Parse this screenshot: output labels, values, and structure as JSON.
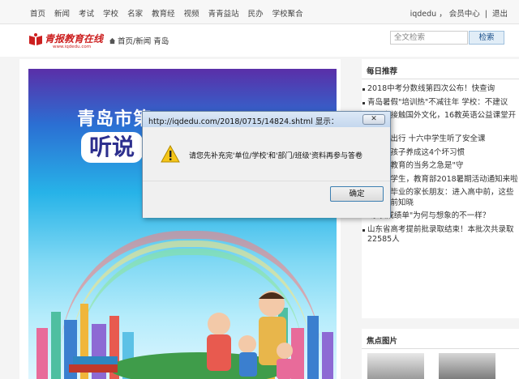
{
  "topbar": {
    "nav": [
      "首页",
      "新闻",
      "考试",
      "学校",
      "名家",
      "教育经",
      "视频",
      "青青益站",
      "民办",
      "学校聚合"
    ],
    "user": "iqdedu",
    "sep1": "，",
    "member_center": "会员中心",
    "sep2": "|",
    "logout": "退出"
  },
  "logo": {
    "name": "青报教育在线",
    "url": "www.iqdedu.com"
  },
  "breadcrumb": {
    "home": "首页",
    "sep": "/",
    "section": "新闻 青岛"
  },
  "search": {
    "placeholder": "全文检索",
    "button": "检索"
  },
  "poster": {
    "title1": "青岛市第",
    "title2": "听说"
  },
  "sidebar": {
    "title": "每日推荐",
    "items": [
      "2018中考分数线第四次公布！快查询",
      "青岛暑假\"培训热\"不减往年 学校：不建议",
      "近距离接触国外文化，16教英语公益课堂开讲",
      "，安全出行 十六中学生听了安全课",
      "万别让孩子养成这4个坏习惯",
      "：书法教育的当务之急是\"守",
      "@中小学生，教育部2018暑期活动通知来啦",
      "致初三毕业的家长朋友：进入高中前，这些事请提前知晓",
      "\"家长成绩单\"为何与想象的不一样？",
      "山东省高考提前批录取结束！本批次共录取22585人"
    ],
    "focus_title": "焦点图片"
  },
  "dialog": {
    "title": "http://iqdedu.com/2018/0715/14824.shtml 显示：",
    "close": "✕",
    "message": "请您先补充完'单位/学校'和'部门/班级'资料再参与答卷",
    "ok": "确定"
  }
}
